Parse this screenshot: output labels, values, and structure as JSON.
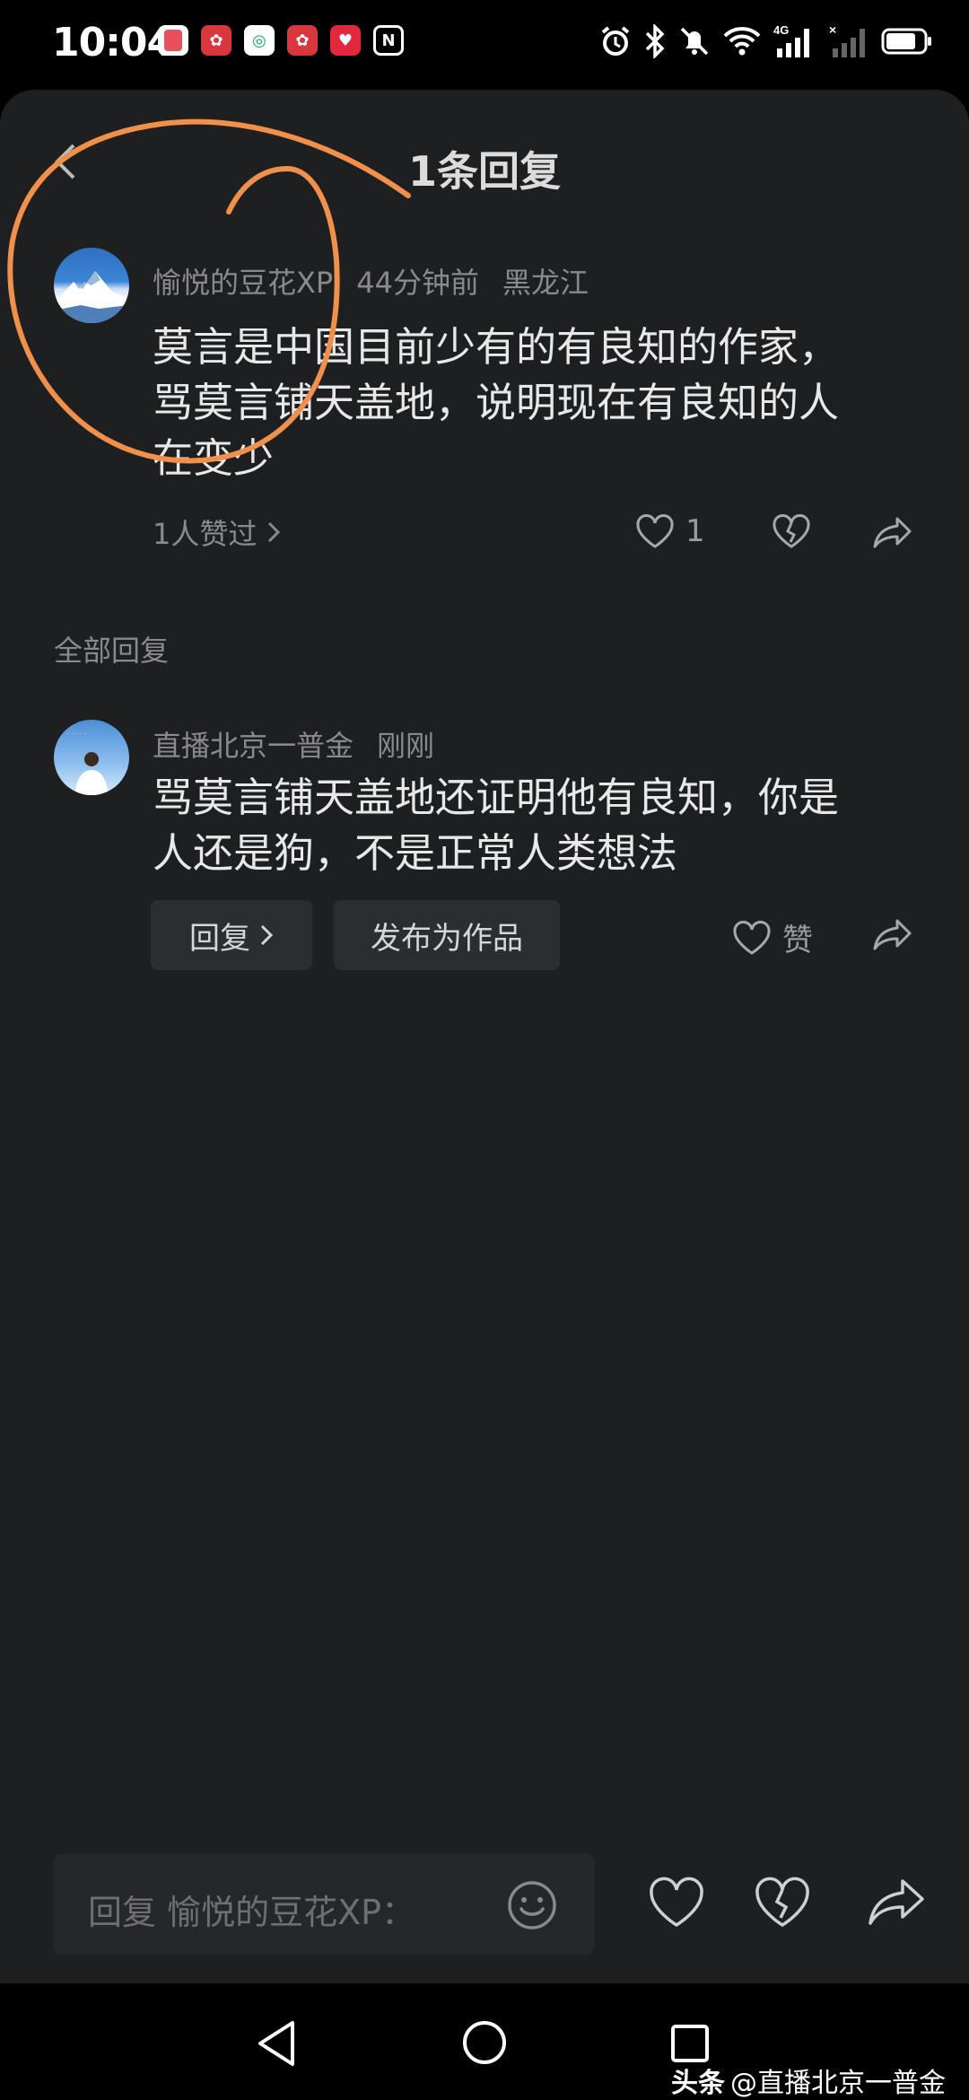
{
  "status_bar": {
    "time": "10:04",
    "app_icons": [
      "app-icon-red",
      "huawei-icon",
      "china-mobile-icon",
      "huawei-icon",
      "heart-app-icon",
      "nfc-icon"
    ],
    "right_icons": [
      "alarm-icon",
      "bluetooth-icon",
      "mute-icon",
      "wifi-icon",
      "4g-signal-icon",
      "no-signal-icon",
      "battery-icon"
    ]
  },
  "header": {
    "title": "1条回复",
    "back_icon": "chevron-left-icon"
  },
  "main_comment": {
    "author": "愉悦的豆花XP",
    "time": "44分钟前",
    "location": "黑龙江",
    "text_lines": [
      "莫言是中国目前少有的有良知的作家，",
      "骂莫言铺天盖地，说明现在有良知的人",
      "在变少"
    ],
    "likes_summary": "1人赞过",
    "like_count": "1"
  },
  "section": {
    "label": "全部回复"
  },
  "reply": {
    "author": "直播北京一普金",
    "time": "刚刚",
    "text_lines": [
      "骂莫言铺天盖地还证明他有良知，你是",
      "人还是狗，不是正常人类想法"
    ],
    "reply_button": "回复",
    "publish_button": "发布为作品",
    "like_label": "赞"
  },
  "input_bar": {
    "placeholder": "回复 愉悦的豆花XP："
  },
  "watermark": {
    "brand": "头条",
    "handle": "@直播北京一普金"
  },
  "colors": {
    "sheet_bg": "#1e1f21",
    "annotation_orange": "#f0904a",
    "muted_text": "#8a8a8a"
  }
}
